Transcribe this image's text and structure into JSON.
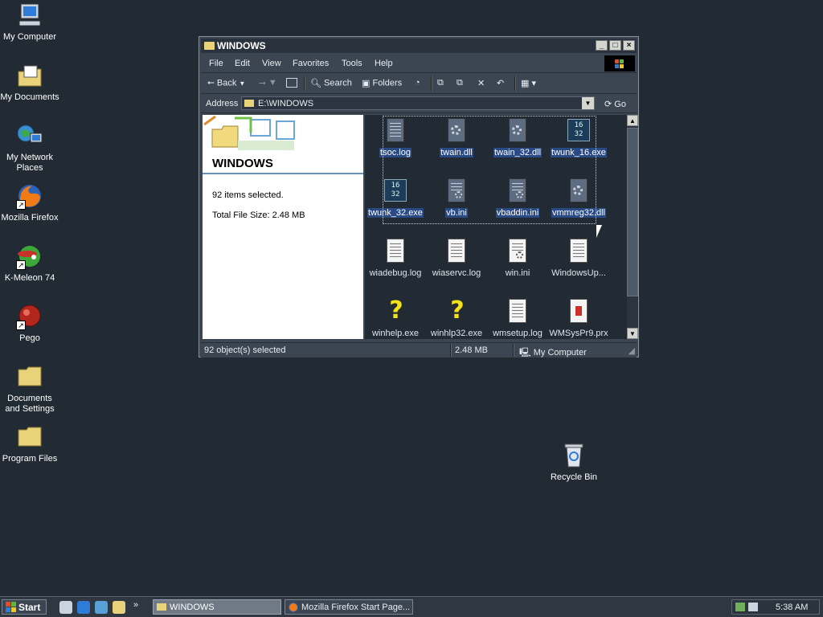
{
  "desktop": {
    "icons": [
      {
        "label": "My Computer"
      },
      {
        "label": "My Documents"
      },
      {
        "label": "My Network Places"
      },
      {
        "label": "Mozilla Firefox"
      },
      {
        "label": "K-Meleon 74"
      },
      {
        "label": "Pego"
      },
      {
        "label": "Documents and Settings"
      },
      {
        "label": "Program Files"
      }
    ],
    "recycle_bin": {
      "label": "Recycle Bin"
    }
  },
  "window": {
    "title": "WINDOWS",
    "menu": [
      "File",
      "Edit",
      "View",
      "Favorites",
      "Tools",
      "Help"
    ],
    "toolbar": {
      "back": "Back",
      "search": "Search",
      "folders": "Folders"
    },
    "address": {
      "label": "Address",
      "value": "E:\\WINDOWS",
      "go": "Go"
    },
    "left_pane": {
      "title": "WINDOWS",
      "selected_count": "92 items selected.",
      "total_size": "Total File Size: 2.48 MB"
    },
    "files": [
      {
        "name": "tsoc.log",
        "icon": "text-doc-icon",
        "selected": true
      },
      {
        "name": "twain.dll",
        "icon": "dll-gear-icon",
        "selected": true
      },
      {
        "name": "twain_32.dll",
        "icon": "dll-gear-icon",
        "selected": true
      },
      {
        "name": "twunk_16.exe",
        "icon": "exe-1632-icon",
        "selected": true
      },
      {
        "name": "twunk_32.exe",
        "icon": "exe-1632-icon",
        "selected": true
      },
      {
        "name": "vb.ini",
        "icon": "ini-icon",
        "selected": true
      },
      {
        "name": "vbaddin.ini",
        "icon": "ini-icon",
        "selected": true
      },
      {
        "name": "vmmreg32.dll",
        "icon": "dll-gear-icon",
        "selected": true
      },
      {
        "name": "wiadebug.log",
        "icon": "text-doc-icon",
        "selected": false
      },
      {
        "name": "wiaservc.log",
        "icon": "text-doc-icon",
        "selected": false
      },
      {
        "name": "win.ini",
        "icon": "ini-icon",
        "selected": false
      },
      {
        "name": "WindowsUp...",
        "icon": "text-doc-icon",
        "selected": false
      },
      {
        "name": "winhelp.exe",
        "icon": "help-icon",
        "selected": false
      },
      {
        "name": "winhlp32.exe",
        "icon": "help-icon",
        "selected": false
      },
      {
        "name": "wmsetup.log",
        "icon": "text-doc-icon",
        "selected": false
      },
      {
        "name": "WMSysPr9.prx",
        "icon": "media-doc-icon",
        "selected": false
      }
    ],
    "status": {
      "objects": "92 object(s) selected",
      "size": "2.48 MB",
      "zone": "My Computer"
    }
  },
  "taskbar": {
    "start": "Start",
    "tasks": [
      {
        "label": "WINDOWS",
        "active": true
      },
      {
        "label": "Mozilla Firefox Start Page...",
        "active": false
      }
    ],
    "clock": "5:38 AM"
  }
}
